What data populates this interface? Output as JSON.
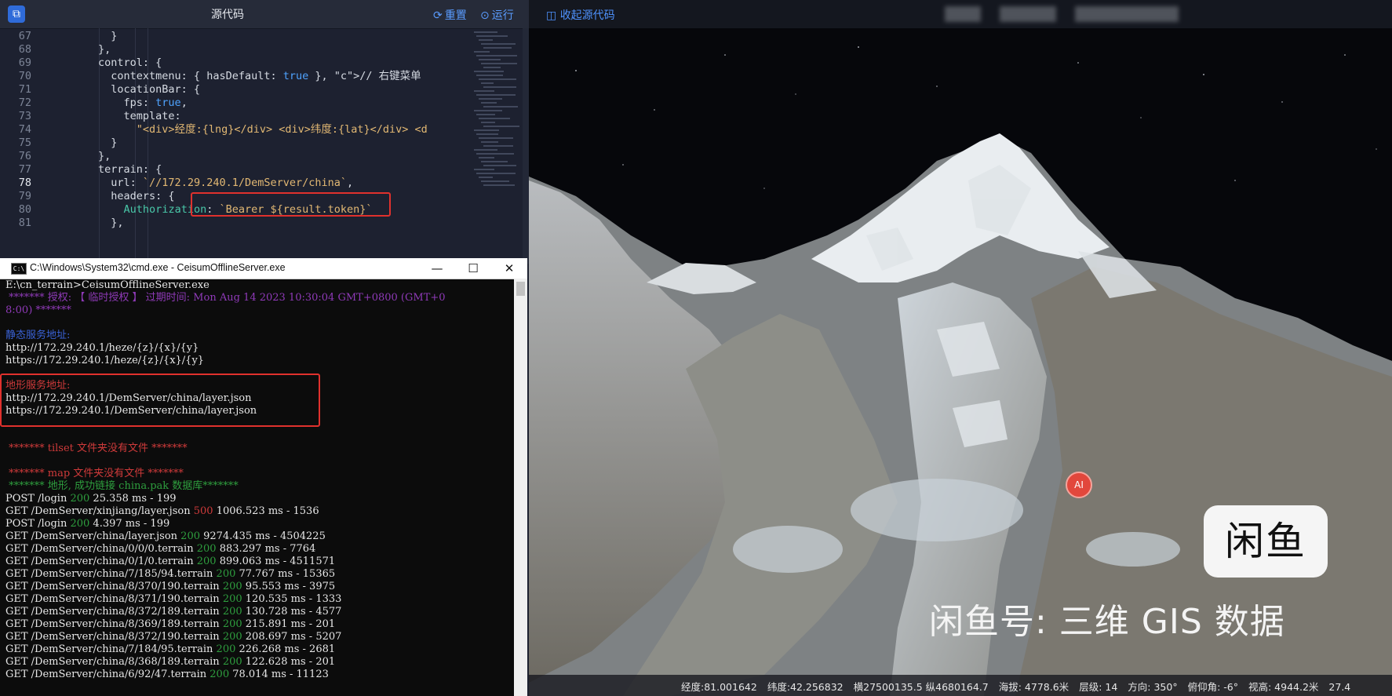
{
  "editor": {
    "title": "源代码",
    "reset_label": "重置",
    "run_label": "运行",
    "reset_icon": "refresh-icon",
    "run_icon": "play-circle-icon",
    "code_lines": [
      {
        "no": "67",
        "text": "          }"
      },
      {
        "no": "68",
        "text": "        },"
      },
      {
        "no": "69",
        "text": "        control: {"
      },
      {
        "no": "70",
        "text": "          contextmenu: { hasDefault: true }, // 右键菜单"
      },
      {
        "no": "71",
        "text": "          locationBar: {"
      },
      {
        "no": "72",
        "text": "            fps: true,"
      },
      {
        "no": "73",
        "text": "            template:"
      },
      {
        "no": "74",
        "text": "              \"<div>经度:{lng}</div> <div>纬度:{lat}</div> <d"
      },
      {
        "no": "75",
        "text": "          }"
      },
      {
        "no": "76",
        "text": "        },"
      },
      {
        "no": "77",
        "text": "        terrain: {"
      },
      {
        "no": "78",
        "text": "          url: `//172.29.240.1/DemServer/china`,"
      },
      {
        "no": "79",
        "text": "          headers: {"
      },
      {
        "no": "80",
        "text": "            Authorization: `Bearer ${result.token}`"
      },
      {
        "no": "81",
        "text": "          },"
      }
    ]
  },
  "cmd": {
    "title": "C:\\Windows\\System32\\cmd.exe - CeisumOfflineServer.exe",
    "icon_text": "C:\\",
    "minimize": "—",
    "maximize": "☐",
    "close": "✕",
    "lines": [
      {
        "text": "E:\\cn_terrain>CeisumOfflineServer.exe",
        "color": "cw"
      },
      {
        "text": " ******* 授权: 【 临时授权 】 过期时间: Mon Aug 14 2023 10:30:04 GMT+0800 (GMT+0",
        "color": "cp"
      },
      {
        "text": "8:00) *******",
        "color": "cp"
      },
      {
        "text": "",
        "color": "cw"
      },
      {
        "text": "静态服务地址:",
        "color": "cb"
      },
      {
        "text": "http://172.29.240.1/heze/{z}/{x}/{y}",
        "color": "cw"
      },
      {
        "text": "https://172.29.240.1/heze/{z}/{x}/{y}",
        "color": "cw"
      },
      {
        "text": "",
        "color": "cw"
      },
      {
        "text": "地形服务地址:",
        "color": "cr"
      },
      {
        "text": "http://172.29.240.1/DemServer/china/layer.json",
        "color": "cw"
      },
      {
        "text": "https://172.29.240.1/DemServer/china/layer.json",
        "color": "cw"
      },
      {
        "text": "",
        "color": "cw"
      },
      {
        "text": "",
        "color": "cw"
      },
      {
        "text": " ******* tilset 文件夹没有文件 *******",
        "color": "cr"
      },
      {
        "text": "",
        "color": "cw"
      },
      {
        "text": " ******* map 文件夹没有文件 *******",
        "color": "cr"
      },
      {
        "text": " ******* 地形, 成功链接 china.pak 数据库*******",
        "color": "cg"
      }
    ],
    "requests": [
      {
        "pre": "POST /login ",
        "status": "200",
        "post": " 25.358 ms - 199",
        "ok": true
      },
      {
        "pre": "GET /DemServer/xinjiang/layer.json ",
        "status": "500",
        "post": " 1006.523 ms - 1536",
        "ok": false
      },
      {
        "pre": "POST /login ",
        "status": "200",
        "post": " 4.397 ms - 199",
        "ok": true
      },
      {
        "pre": "GET /DemServer/china/layer.json ",
        "status": "200",
        "post": " 9274.435 ms - 4504225",
        "ok": true
      },
      {
        "pre": "GET /DemServer/china/0/0/0.terrain ",
        "status": "200",
        "post": " 883.297 ms - 7764",
        "ok": true
      },
      {
        "pre": "GET /DemServer/china/0/1/0.terrain ",
        "status": "200",
        "post": " 899.063 ms - 4511571",
        "ok": true
      },
      {
        "pre": "GET /DemServer/china/7/185/94.terrain ",
        "status": "200",
        "post": " 77.767 ms - 15365",
        "ok": true
      },
      {
        "pre": "GET /DemServer/china/8/370/190.terrain ",
        "status": "200",
        "post": " 95.553 ms - 3975",
        "ok": true
      },
      {
        "pre": "GET /DemServer/china/8/371/190.terrain ",
        "status": "200",
        "post": " 120.535 ms - 1333",
        "ok": true
      },
      {
        "pre": "GET /DemServer/china/8/372/189.terrain ",
        "status": "200",
        "post": " 130.728 ms - 4577",
        "ok": true
      },
      {
        "pre": "GET /DemServer/china/8/369/189.terrain ",
        "status": "200",
        "post": " 215.891 ms - 201",
        "ok": true
      },
      {
        "pre": "GET /DemServer/china/8/372/190.terrain ",
        "status": "200",
        "post": " 208.697 ms - 5207",
        "ok": true
      },
      {
        "pre": "GET /DemServer/china/7/184/95.terrain ",
        "status": "200",
        "post": " 226.268 ms - 2681",
        "ok": true
      },
      {
        "pre": "GET /DemServer/china/8/368/189.terrain ",
        "status": "200",
        "post": " 122.628 ms - 201",
        "ok": true
      },
      {
        "pre": "GET /DemServer/china/6/92/47.terrain ",
        "status": "200",
        "post": " 78.014 ms - 11123",
        "ok": true
      }
    ]
  },
  "map": {
    "collapse_label": "收起源代码",
    "collapse_icon": "collapse-panel-icon",
    "marker_text": "AI",
    "watermark_logo": "闲鱼",
    "watermark_text": "闲鱼号: 三维 GIS 数据",
    "status": [
      "经度:81.001642",
      "纬度:42.256832",
      "横27500135.5 纵4680164.7",
      "海拔: 4778.6米",
      "层级: 14",
      "方向: 350°",
      "俯仰角: -6°",
      "视高: 4944.2米",
      "27.4"
    ]
  },
  "colors": {
    "accent": "#4f93ff",
    "highlight_box": "#e0312d",
    "status_ok": "#2e9e3e",
    "status_error": "#cf3a3a"
  }
}
